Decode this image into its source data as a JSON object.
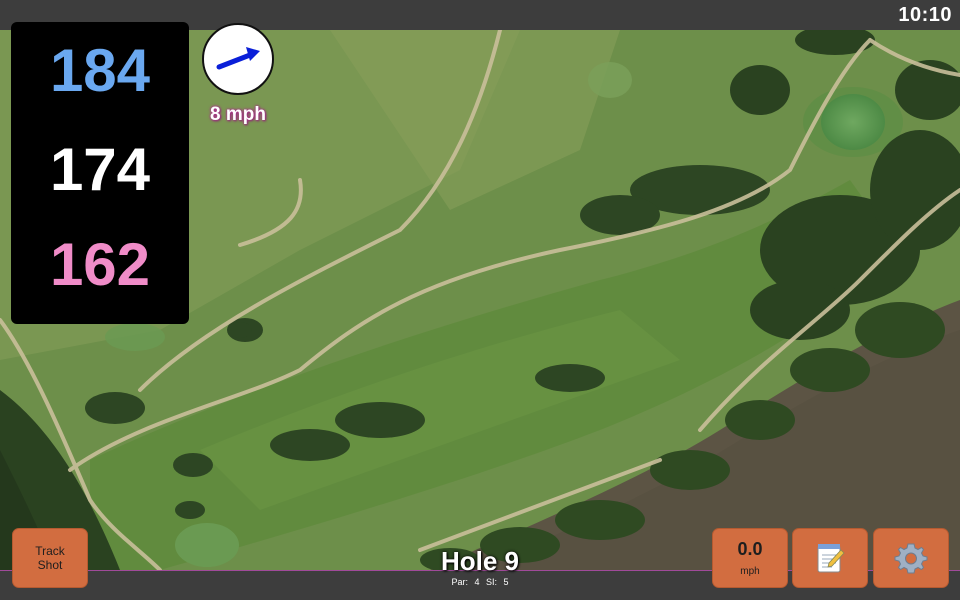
{
  "status": {
    "time": "10:10"
  },
  "distances": {
    "back": "184",
    "center": "174",
    "front": "162",
    "colors": {
      "back": "#6aa8f0",
      "center": "#ffffff",
      "front": "#f08cc8"
    }
  },
  "wind": {
    "speed_label": "8 mph",
    "direction_icon": "wind-arrow-icon",
    "arrow_color": "#0a1fd8"
  },
  "hole": {
    "title": "Hole 9",
    "par_label": "Par: 4",
    "si_label": "SI: 5"
  },
  "buttons": {
    "track_line1": "Track",
    "track_line2": "Shot",
    "speed_value": "0.0",
    "speed_unit": "mph",
    "note_icon": "notepad-icon",
    "settings_icon": "gear-icon",
    "accent_color": "#d26d40"
  },
  "theme": {
    "bar_color": "#3d3d3d",
    "bar_border": "#a04a9a"
  }
}
